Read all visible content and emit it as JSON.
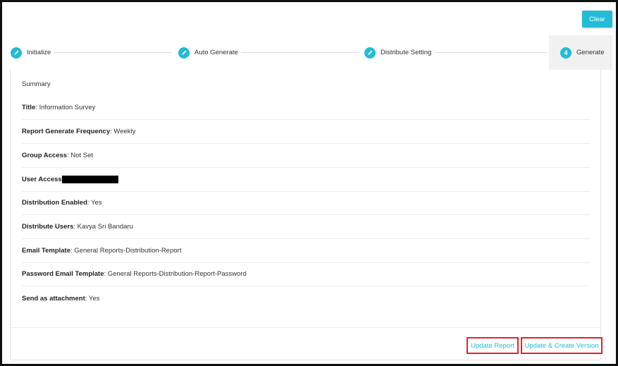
{
  "toolbar": {
    "clear_label": "Clear"
  },
  "stepper": {
    "steps": [
      {
        "label": "Initialize",
        "icon": "pencil-icon",
        "marker": ""
      },
      {
        "label": "Auto Generate",
        "icon": "pencil-icon",
        "marker": ""
      },
      {
        "label": "Distribute Setting",
        "icon": "pencil-icon",
        "marker": ""
      },
      {
        "label": "Generate",
        "icon": "",
        "marker": "4"
      }
    ]
  },
  "summary": {
    "heading": "Summary",
    "rows": [
      {
        "key": "Title",
        "value": ": Information Survey"
      },
      {
        "key": "Report Generate Frequency",
        "value": ": Weekly"
      },
      {
        "key": "Group Access",
        "value": ": Not Set"
      },
      {
        "key": "User Access",
        "value": ""
      },
      {
        "key": "Distribution Enabled",
        "value": ": Yes"
      },
      {
        "key": "Distribute Users",
        "value": ": Kavya Sri Bandaru"
      },
      {
        "key": "Email Template",
        "value": ": General Reports-Distribution-Report"
      },
      {
        "key": "Password Email Template",
        "value": ": General Reports-Distribution-Report-Password"
      },
      {
        "key": "Send as attachment",
        "value": ": Yes"
      }
    ]
  },
  "actions": {
    "update_report": "Update Report",
    "update_create_version": "Update & Create Version"
  },
  "colors": {
    "accent": "#22bcd6",
    "highlight": "#e0252b",
    "active_step_bg": "#f1f1f1"
  }
}
